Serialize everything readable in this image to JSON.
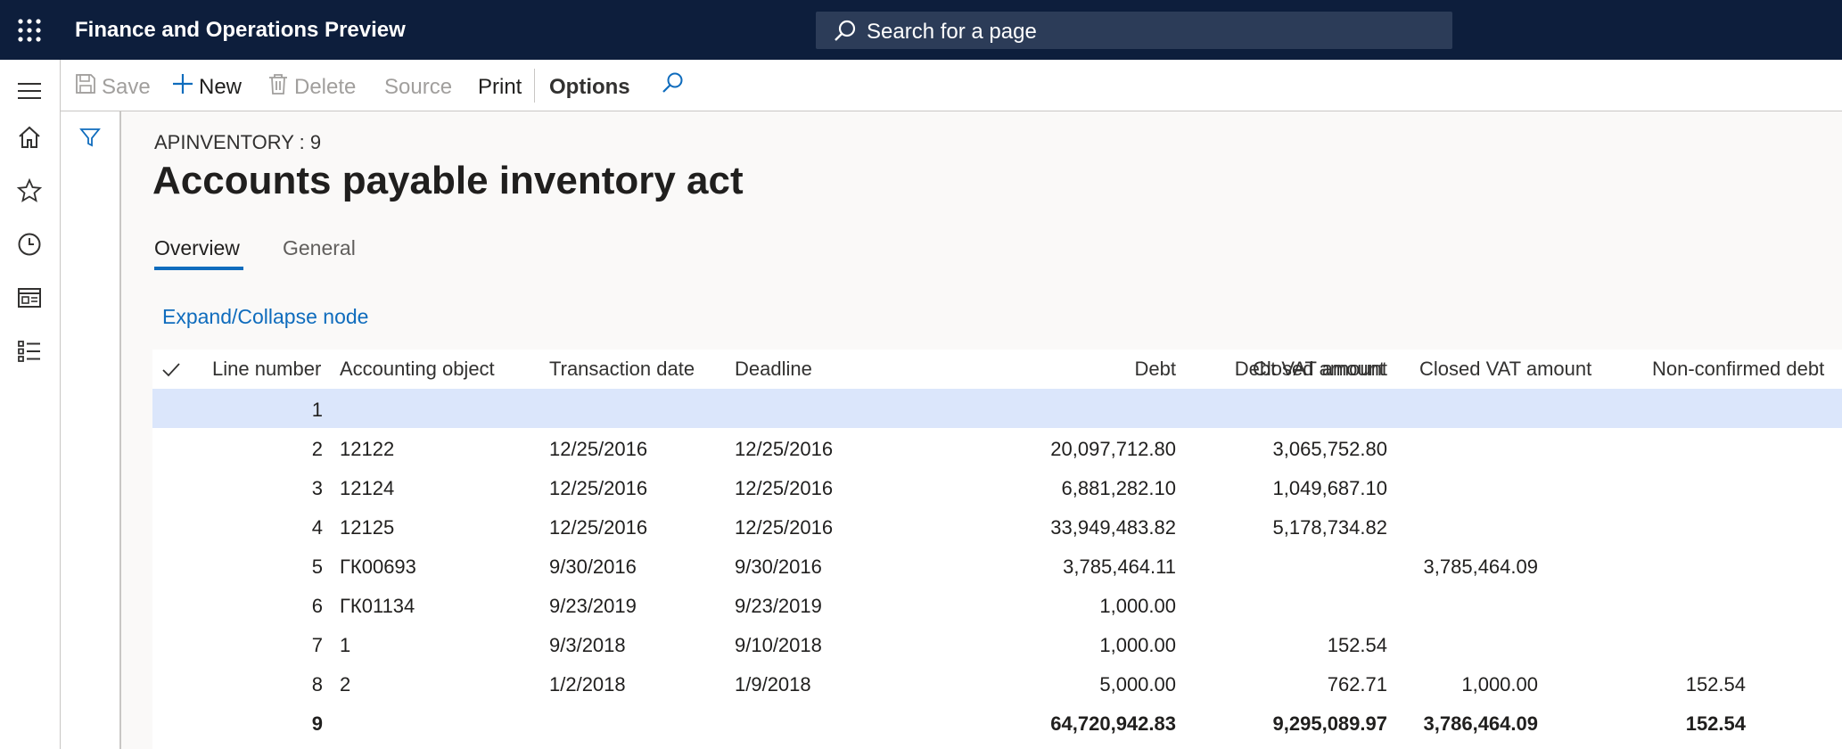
{
  "app": {
    "title": "Finance and Operations Preview"
  },
  "search": {
    "placeholder": "Search for a page"
  },
  "actions": {
    "save": "Save",
    "new": "New",
    "delete": "Delete",
    "source": "Source",
    "print": "Print",
    "options": "Options"
  },
  "page": {
    "breadcrumb": "APINVENTORY : 9",
    "title": "Accounts payable inventory act"
  },
  "tabs": [
    {
      "label": "Overview",
      "active": true
    },
    {
      "label": "General",
      "active": false
    }
  ],
  "link": {
    "expand": "Expand/Collapse node"
  },
  "columns": [
    "Line number",
    "Accounting object",
    "Transaction date",
    "Deadline",
    "Debt",
    "Debt VAT amount",
    "Closed amount",
    "Closed VAT amount",
    "Non-confirmed debt"
  ],
  "rows": [
    {
      "line": "1",
      "object": "",
      "tdate": "",
      "deadline": "",
      "debt": "",
      "debt_vat": "",
      "closed": "",
      "closed_vat": "",
      "nonconf": ""
    },
    {
      "line": "2",
      "object": "12122",
      "tdate": "12/25/2016",
      "deadline": "12/25/2016",
      "debt": "20,097,712.80",
      "debt_vat": "3,065,752.80",
      "closed": "",
      "closed_vat": "",
      "nonconf": ""
    },
    {
      "line": "3",
      "object": "12124",
      "tdate": "12/25/2016",
      "deadline": "12/25/2016",
      "debt": "6,881,282.10",
      "debt_vat": "1,049,687.10",
      "closed": "",
      "closed_vat": "",
      "nonconf": ""
    },
    {
      "line": "4",
      "object": "12125",
      "tdate": "12/25/2016",
      "deadline": "12/25/2016",
      "debt": "33,949,483.82",
      "debt_vat": "5,178,734.82",
      "closed": "",
      "closed_vat": "",
      "nonconf": ""
    },
    {
      "line": "5",
      "object": "ГК00693",
      "tdate": "9/30/2016",
      "deadline": "9/30/2016",
      "debt": "3,785,464.11",
      "debt_vat": "",
      "closed": "3,785,464.09",
      "closed_vat": "",
      "nonconf": ""
    },
    {
      "line": "6",
      "object": "ГК01134",
      "tdate": "9/23/2019",
      "deadline": "9/23/2019",
      "debt": "1,000.00",
      "debt_vat": "",
      "closed": "",
      "closed_vat": "",
      "nonconf": ""
    },
    {
      "line": "7",
      "object": "1",
      "tdate": "9/3/2018",
      "deadline": "9/10/2018",
      "debt": "1,000.00",
      "debt_vat": "152.54",
      "closed": "",
      "closed_vat": "",
      "nonconf": ""
    },
    {
      "line": "8",
      "object": "2",
      "tdate": "1/2/2018",
      "deadline": "1/9/2018",
      "debt": "5,000.00",
      "debt_vat": "762.71",
      "closed": "1,000.00",
      "closed_vat": "152.54",
      "nonconf": ""
    },
    {
      "line": "9",
      "object": "",
      "tdate": "",
      "deadline": "",
      "debt": "64,720,942.83",
      "debt_vat": "9,295,089.97",
      "closed": "3,786,464.09",
      "closed_vat": "152.54",
      "nonconf": ""
    }
  ],
  "colors": {
    "topbar": "#0d1e3c",
    "accent": "#0f6cbd",
    "selected_row": "#dbe6fb"
  }
}
